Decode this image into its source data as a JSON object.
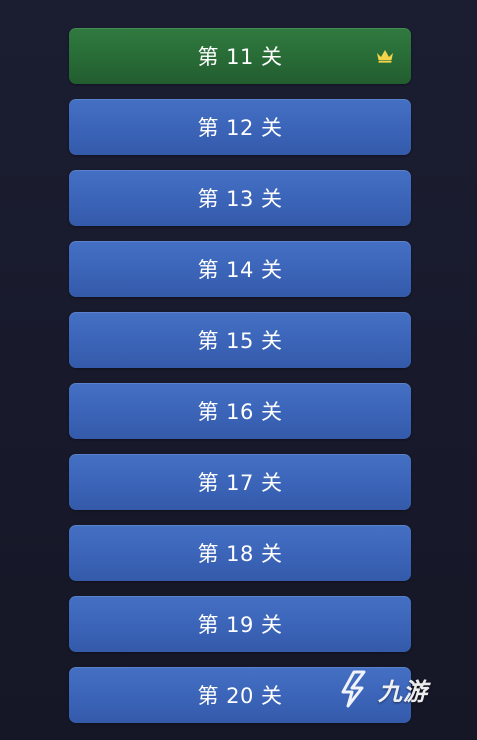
{
  "levels": [
    {
      "label": "第 11 关",
      "status": "completed",
      "badge_icon": "crown-icon",
      "color": "#2b7239"
    },
    {
      "label": "第 12 关",
      "status": "unlocked",
      "color": "#3d66ba"
    },
    {
      "label": "第 13 关",
      "status": "unlocked",
      "color": "#3d66ba"
    },
    {
      "label": "第 14 关",
      "status": "unlocked",
      "color": "#3d66ba"
    },
    {
      "label": "第 15 关",
      "status": "unlocked",
      "color": "#3d66ba"
    },
    {
      "label": "第 16 关",
      "status": "unlocked",
      "color": "#3d66ba"
    },
    {
      "label": "第 17 关",
      "status": "unlocked",
      "color": "#3d66ba"
    },
    {
      "label": "第 18 关",
      "status": "unlocked",
      "color": "#3d66ba"
    },
    {
      "label": "第 19 关",
      "status": "unlocked",
      "color": "#3d66ba"
    },
    {
      "label": "第 20 关",
      "status": "unlocked",
      "color": "#3d66ba"
    }
  ],
  "watermark": {
    "text": "九游",
    "icon": "jiuyou-logo-icon"
  },
  "colors": {
    "background": "#1a1c2e",
    "completed_button": "#2b7239",
    "level_button": "#3d66ba",
    "crown": "#f2d44a",
    "label": "#ffffff"
  }
}
